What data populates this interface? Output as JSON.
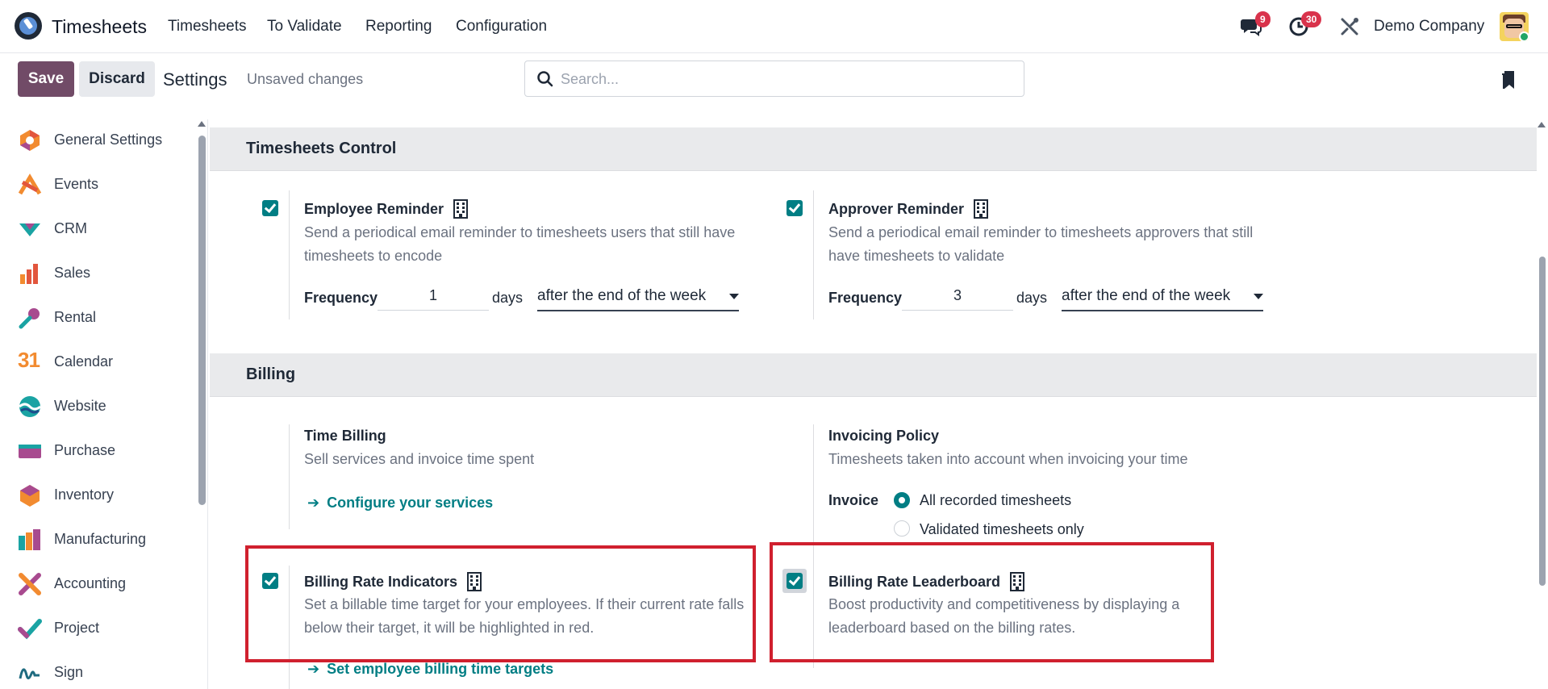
{
  "topnav": {
    "app_title": "Timesheets",
    "menu": [
      "Timesheets",
      "To Validate",
      "Reporting",
      "Configuration"
    ],
    "messages_count": "9",
    "activities_count": "30",
    "company": "Demo Company"
  },
  "control": {
    "save_label": "Save",
    "discard_label": "Discard",
    "title": "Settings",
    "status": "Unsaved changes",
    "search_placeholder": "Search..."
  },
  "sidebar": {
    "items": [
      {
        "label": "General Settings",
        "icon": "general-settings-icon"
      },
      {
        "label": "Events",
        "icon": "events-icon"
      },
      {
        "label": "CRM",
        "icon": "crm-icon"
      },
      {
        "label": "Sales",
        "icon": "sales-icon"
      },
      {
        "label": "Rental",
        "icon": "rental-icon"
      },
      {
        "label": "Calendar",
        "icon": "calendar-icon"
      },
      {
        "label": "Website",
        "icon": "website-icon"
      },
      {
        "label": "Purchase",
        "icon": "purchase-icon"
      },
      {
        "label": "Inventory",
        "icon": "inventory-icon"
      },
      {
        "label": "Manufacturing",
        "icon": "manufacturing-icon"
      },
      {
        "label": "Accounting",
        "icon": "accounting-icon"
      },
      {
        "label": "Project",
        "icon": "project-icon"
      },
      {
        "label": "Sign",
        "icon": "sign-icon"
      }
    ],
    "calendar_icon_text": "31"
  },
  "timesheets_control": {
    "title": "Timesheets Control",
    "employee_reminder": {
      "title": "Employee Reminder",
      "checked": true,
      "description": "Send a periodical email reminder to timesheets users that still have timesheets to encode",
      "frequency_label": "Frequency",
      "frequency_value": "1",
      "unit": "days",
      "period": "after the end of the week"
    },
    "approver_reminder": {
      "title": "Approver Reminder",
      "checked": true,
      "description": "Send a periodical email reminder to timesheets approvers that still have timesheets to validate",
      "frequency_label": "Frequency",
      "frequency_value": "3",
      "unit": "days",
      "period": "after the end of the week"
    }
  },
  "billing": {
    "title": "Billing",
    "time_billing": {
      "title": "Time Billing",
      "description": "Sell services and invoice time spent",
      "link": "Configure your services"
    },
    "invoicing_policy": {
      "title": "Invoicing Policy",
      "description": "Timesheets taken into account when invoicing your time",
      "invoice_label": "Invoice",
      "options": [
        "All recorded timesheets",
        "Validated timesheets only"
      ],
      "selected": "All recorded timesheets"
    },
    "billing_rate_indicators": {
      "title": "Billing Rate Indicators",
      "checked": true,
      "description": "Set a billable time target for your employees. If their current rate falls below their target, it will be highlighted in red.",
      "link": "Set employee billing time targets"
    },
    "billing_rate_leaderboard": {
      "title": "Billing Rate Leaderboard",
      "checked": true,
      "description": "Boost productivity and competitiveness by displaying a leaderboard based on the billing rates."
    }
  },
  "colors": {
    "brand": "#714b67",
    "accent": "#017e84",
    "highlight": "#d0202e",
    "badge": "#d9334c"
  }
}
